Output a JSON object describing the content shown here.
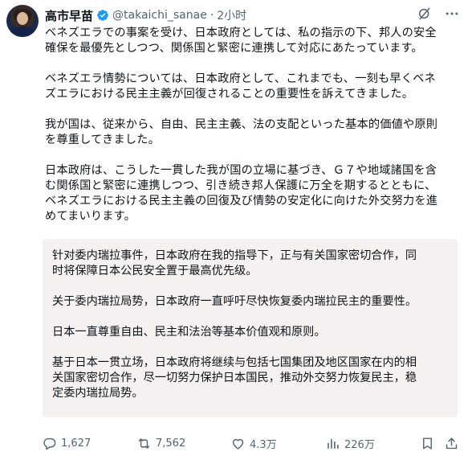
{
  "author": {
    "name": "高市早苗",
    "handle": "@takaichi_sanae",
    "separator": "·",
    "time": "2小时"
  },
  "icons": {
    "verified": "verified-badge-icon",
    "grok": "grok-icon",
    "more": "more-options-icon",
    "reply": "reply-icon",
    "retweet": "retweet-icon",
    "like": "heart-icon",
    "views": "views-chart-icon",
    "bookmark": "bookmark-icon",
    "share": "share-icon"
  },
  "colors": {
    "verified_badge": "#1d9bf0",
    "text_primary": "#0f1419",
    "text_secondary": "#536471",
    "translation_bg": "#f5f1f0"
  },
  "tweet": {
    "paragraphs": [
      "ベネズエラでの事案を受け、日本政府としては、私の指示の下、邦人の安全\n確保を最優先としつつ、関係国と緊密に連携して対応にあたっています。",
      "ベネズエラ情勢については、日本政府として、これまでも、一刻も早くベネ\nズエラにおける民主主義が回復されることの重要性を訴えてきました。",
      "我が国は、従来から、自由、民主主義、法の支配といった基本的価値や原則\nを尊重してきました。",
      "日本政府は、こうした一貫した我が国の立場に基づき、Ｇ７や地域諸国を含\nむ関係国と緊密に連携しつつ、引き続き邦人保護に万全を期するとともに、\nベネズエラにおける民主主義の回復及び情勢の安定化に向けた外交努力を進\nめてまいります。"
    ]
  },
  "translation": {
    "paragraphs": [
      "针对委内瑞拉事件，日本政府在我的指导下，正与有关国家密切合作，同\n时将保障日本公民安全置于最高优先级。",
      "关于委内瑞拉局势，日本政府一直呼吁尽快恢复委内瑞拉民主的重要性。",
      "日本一直尊重自由、民主和法治等基本价值观和原则。",
      "基于日本一贯立场，日本政府将继续与包括七国集团及地区国家在内的相\n关国家密切合作，尽一切努力保护日本国民，推动外交努力恢复民主，稳\n定委内瑞拉局势。"
    ]
  },
  "stats": {
    "replies": "1,627",
    "retweets": "7,562",
    "likes": "4.3万",
    "views": "226万"
  }
}
